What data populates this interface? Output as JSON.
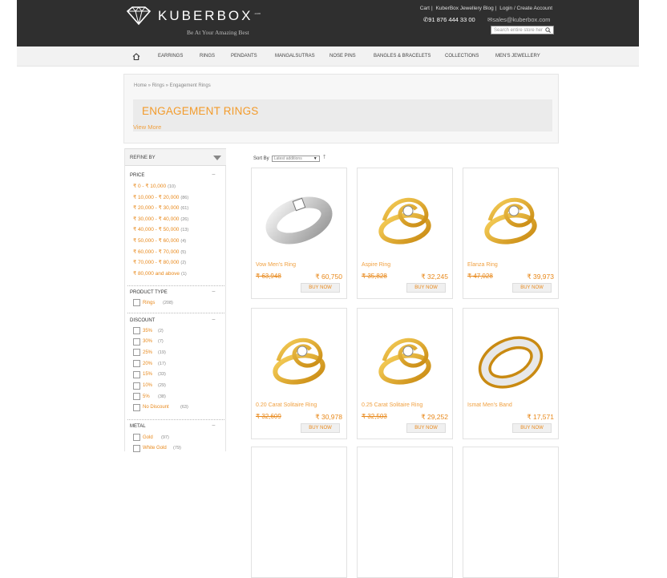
{
  "header": {
    "logo_text": "KUBERBOX",
    "logo_sup": ".com",
    "tagline": "Be At Your Amazing Best",
    "top_links": [
      "Cart",
      "KuberBox Jewellery Blog",
      "Login / Create Account"
    ],
    "phone": "91 876 444 33 00",
    "email": "sales@kuberbox.com",
    "search_placeholder": "Search entire store her"
  },
  "nav": {
    "items": [
      "EARRINGS",
      "RINGS",
      "PENDANTS",
      "MANGALSUTRAS",
      "NOSE PINS",
      "BANGLES & BRACELETS",
      "COLLECTIONS",
      "MEN'S JEWELLERY"
    ]
  },
  "page": {
    "breadcrumb": "Home » Rings » Engagement Rings",
    "title": "ENGAGEMENT RINGS",
    "view_more": "View More"
  },
  "sidebar": {
    "refine_label": "REFINE BY",
    "price_label": "PRICE",
    "price_ranges": [
      {
        "label": "₹ 0 - ₹ 10,000",
        "count": "(10)"
      },
      {
        "label": "₹ 10,000 - ₹ 20,000",
        "count": "(86)"
      },
      {
        "label": "₹ 20,000 - ₹ 30,000",
        "count": "(61)"
      },
      {
        "label": "₹ 30,000 - ₹ 40,000",
        "count": "(26)"
      },
      {
        "label": "₹ 40,000 - ₹ 50,000",
        "count": "(13)"
      },
      {
        "label": "₹ 50,000 - ₹ 60,000",
        "count": "(4)"
      },
      {
        "label": "₹ 60,000 - ₹ 70,000",
        "count": "(5)"
      },
      {
        "label": "₹ 70,000 - ₹ 80,000",
        "count": "(2)"
      },
      {
        "label": "₹ 80,000 and above",
        "count": "(1)"
      }
    ],
    "product_type_label": "PRODUCT TYPE",
    "product_types": [
      {
        "label": "Rings",
        "count": "(208)"
      }
    ],
    "discount_label": "DISCOUNT",
    "discounts": [
      {
        "label": "35%",
        "count": "(2)"
      },
      {
        "label": "30%",
        "count": "(7)"
      },
      {
        "label": "25%",
        "count": "(19)"
      },
      {
        "label": "20%",
        "count": "(17)"
      },
      {
        "label": "15%",
        "count": "(33)"
      },
      {
        "label": "10%",
        "count": "(29)"
      },
      {
        "label": "5%",
        "count": "(38)"
      },
      {
        "label": "No Discount",
        "count": "(63)"
      }
    ],
    "metal_label": "METAL",
    "metals": [
      {
        "label": "Gold",
        "count": "(97)"
      },
      {
        "label": "White Gold",
        "count": "(79)"
      }
    ],
    "collapse_symbol": "−"
  },
  "sort": {
    "label": "Sort By",
    "selected": "Latest additions"
  },
  "products": [
    {
      "name": "Vow Men's Ring",
      "old_price": "₹ 63,948",
      "new_price": "₹ 60,750",
      "buy": "BUY NOW",
      "metal": "white"
    },
    {
      "name": "Aspire Ring",
      "old_price": "₹ 35,828",
      "new_price": "₹ 32,245",
      "buy": "BUY NOW",
      "metal": "gold"
    },
    {
      "name": "Elanza Ring",
      "old_price": "₹ 47,028",
      "new_price": "₹ 39,973",
      "buy": "BUY NOW",
      "metal": "gold"
    },
    {
      "name": "0.20 Carat Solitaire Ring",
      "old_price": "₹ 32,609",
      "new_price": "₹ 30,978",
      "buy": "BUY NOW",
      "metal": "gold"
    },
    {
      "name": "0.25 Carat Solitaire Ring",
      "old_price": "₹ 32,503",
      "new_price": "₹ 29,252",
      "buy": "BUY NOW",
      "metal": "gold"
    },
    {
      "name": "Ismat Men's Band",
      "old_price": "",
      "new_price": "₹ 17,571",
      "buy": "BUY NOW",
      "metal": "twotone"
    }
  ],
  "colors": {
    "accent": "#e8881a",
    "header_bg": "#2f2f2f",
    "gold": "#e0a32a"
  }
}
